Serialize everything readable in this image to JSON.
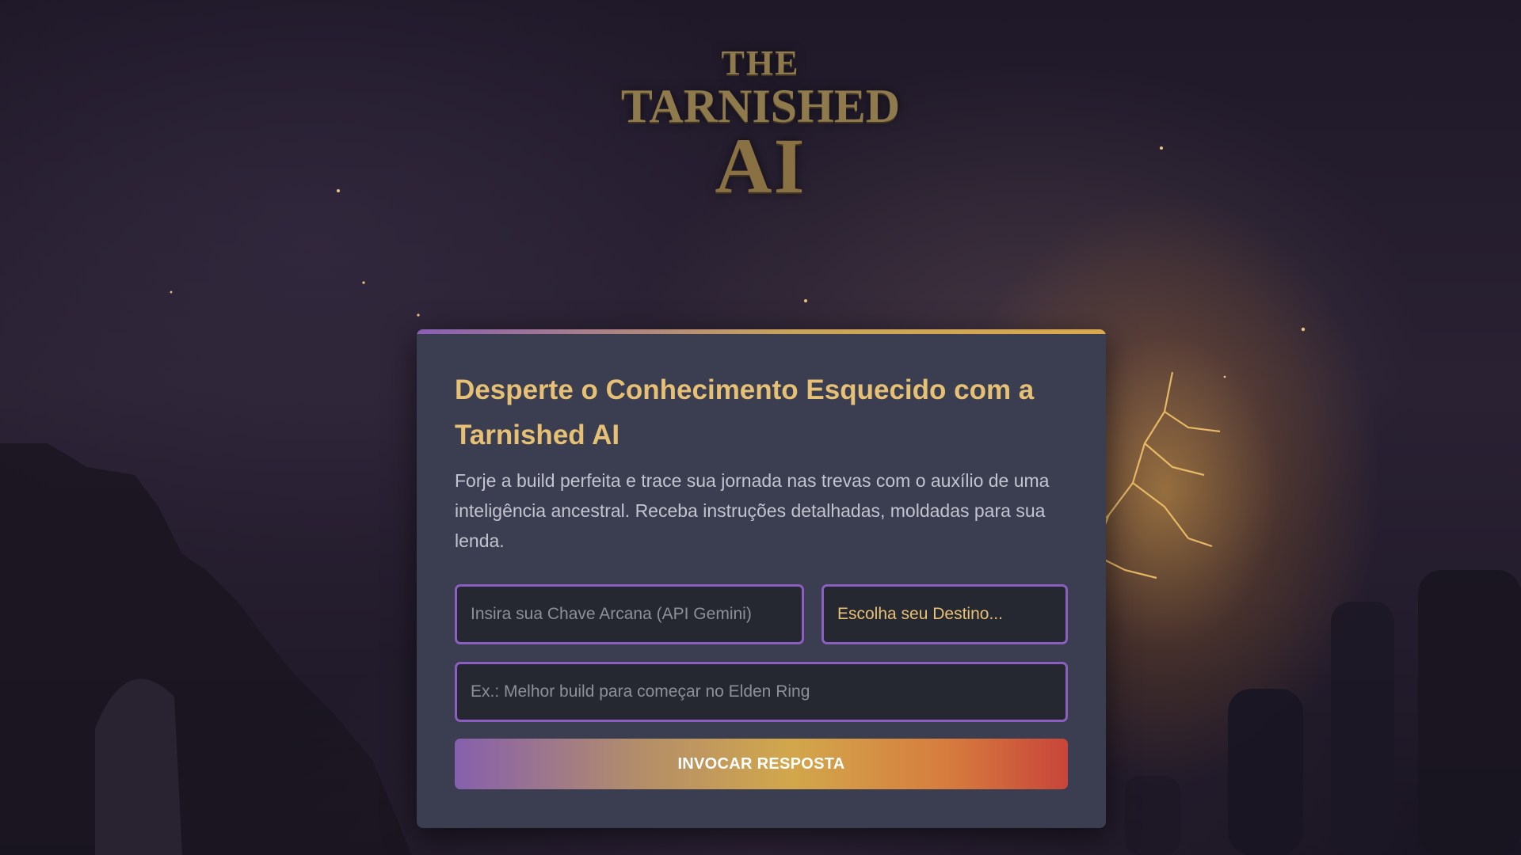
{
  "logo": {
    "line1": "THE",
    "line2": "TARNISHED",
    "line3": "AI"
  },
  "card": {
    "title": "Desperte o Conhecimento Esquecido com a Tarnished AI",
    "description": "Forje a build perfeita e trace sua jornada nas trevas com o auxílio de uma inteligência ancestral. Receba instruções detalhadas, moldadas para sua lenda.",
    "api_key_placeholder": "Insira sua Chave Arcana (API Gemini)",
    "destiny_select_value": "Escolha seu Destino...",
    "query_placeholder": "Ex.: Melhor build para começar no Elden Ring",
    "submit_label": "INVOCAR RESPOSTA"
  },
  "colors": {
    "accent_gold": "#e6c074",
    "accent_purple": "#8a5fc0",
    "card_bg": "#3a3e50",
    "button_gradient_start": "#8660ad",
    "button_gradient_end": "#c8453a"
  }
}
